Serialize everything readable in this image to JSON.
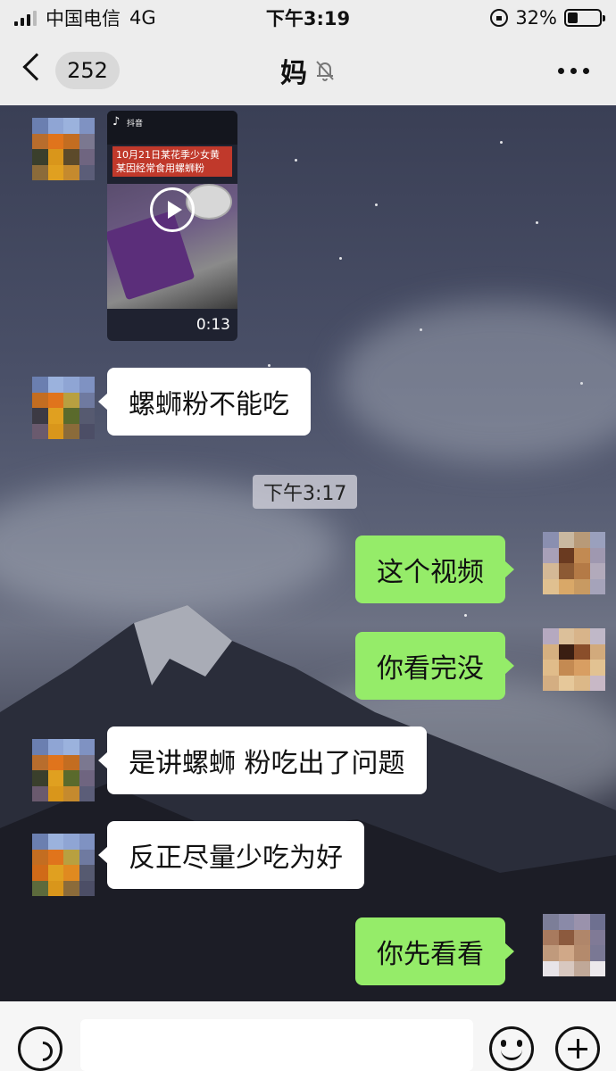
{
  "status_bar": {
    "carrier": "中国电信",
    "network": "4G",
    "time": "下午3:19",
    "battery_percent": "32%",
    "battery_level": 0.32
  },
  "nav": {
    "unread_count": "252",
    "title": "妈",
    "muted": true
  },
  "video_message": {
    "app_label": "抖音",
    "caption": "10月21日某花季少女黄某因经常食用螺蛳粉",
    "duration": "0:13"
  },
  "messages": [
    {
      "sender": "contact",
      "text": "螺蛳粉不能吃"
    },
    {
      "sender": "self",
      "text": "这个视频"
    },
    {
      "sender": "self",
      "text": "你看完没"
    },
    {
      "sender": "contact",
      "text": "是讲螺蛳 粉吃出了问题"
    },
    {
      "sender": "contact",
      "text": "反正尽量少吃为好"
    },
    {
      "sender": "self",
      "text": "你先看看"
    }
  ],
  "time_divider": "下午3:17",
  "colors": {
    "self_bubble": "#95ec69",
    "contact_bubble": "#ffffff",
    "bar_background": "#ededed"
  },
  "icons": [
    "signal-icon",
    "lock-icon",
    "battery-icon",
    "back-icon",
    "mute-icon",
    "more-icon",
    "play-icon",
    "tiktok-icon",
    "voice-icon",
    "emoji-icon",
    "plus-icon"
  ]
}
